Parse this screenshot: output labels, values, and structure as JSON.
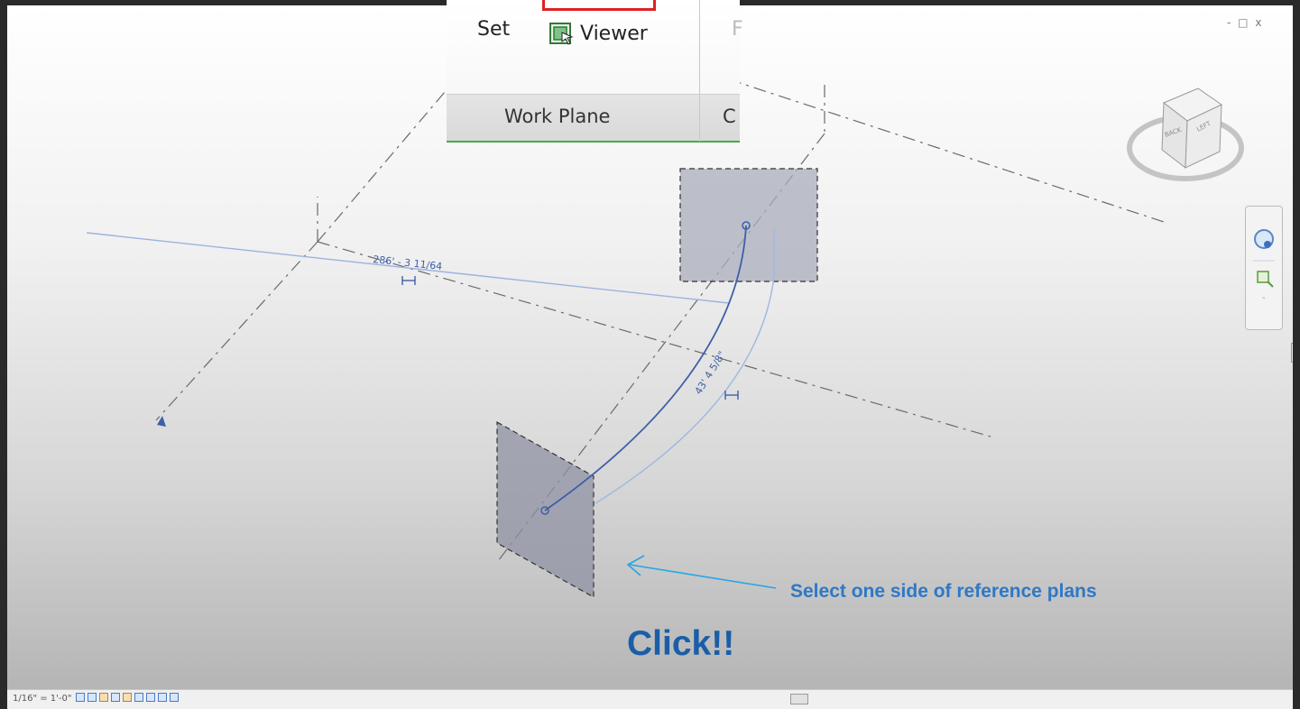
{
  "window": {
    "controls": [
      "-",
      "□",
      "x"
    ]
  },
  "ribbon": {
    "set_label": "Set",
    "viewer_label": "Viewer",
    "next_panel_partial": "F",
    "panel_title": "Work Plane",
    "next_panel_title_partial": "C"
  },
  "canvas": {
    "dimension_linear": "286' - 3 11/64",
    "dimension_arc": "43' 4 5/8\""
  },
  "view_cube": {
    "faces": [
      "LEFT",
      "BACK"
    ]
  },
  "annotations": {
    "instruction": "Select one side of reference plans",
    "click": "Click!!"
  },
  "status_bar": {
    "scale": "1/16\" = 1'-0\""
  },
  "colors": {
    "accent_arrow": "#19a6e6",
    "annotation_text": "#2f78c4",
    "click_text": "#1a5ea8",
    "ribbon_highlight": "#e02020",
    "panel_underline": "#3fae49",
    "model_line": "#4a6fbf"
  },
  "icons": [
    "viewer-icon",
    "arrow-down-icon",
    "view-cube",
    "zoom-icon",
    "pan-icon"
  ]
}
